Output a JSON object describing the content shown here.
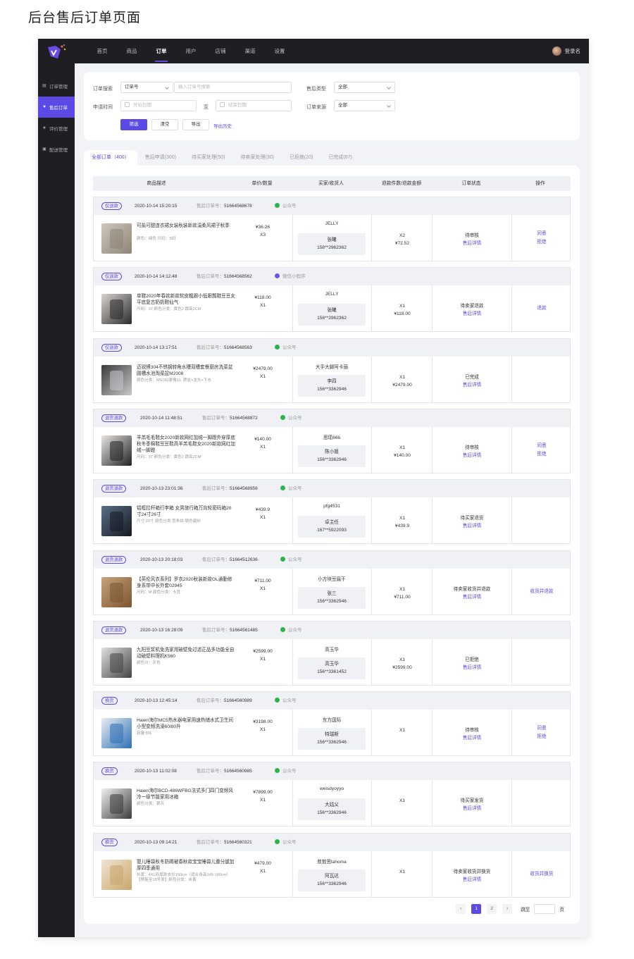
{
  "page_title": "后台售后订单页面",
  "topbar": {
    "nav": [
      "首页",
      "商品",
      "订单",
      "用户",
      "店铺",
      "渠道",
      "设置"
    ],
    "active_index": 2,
    "user_label": "登录名"
  },
  "sidebar": {
    "items": [
      {
        "label": "订单管理",
        "icon": "clipboard-icon",
        "active": false
      },
      {
        "label": "售后订单",
        "icon": "heart-icon",
        "active": true
      },
      {
        "label": "评价管理",
        "icon": "star-icon",
        "active": false
      },
      {
        "label": "配送管理",
        "icon": "box-icon",
        "active": false
      }
    ]
  },
  "filter": {
    "order_search_label": "订单搜索",
    "order_search_select": "订单号",
    "order_search_placeholder": "输入订单号搜索",
    "after_type_label": "售后类型",
    "after_type_value": "全部",
    "apply_time_label": "申请时间",
    "start_placeholder": "开始日期",
    "to_label": "至",
    "end_placeholder": "结束日期",
    "order_source_label": "订单来源",
    "order_source_value": "全部",
    "btn_filter": "筛选",
    "btn_clear": "清空",
    "btn_export": "导出",
    "export_history": "导出历史"
  },
  "tabs": [
    "全部订单（400）",
    "售后申请(300)",
    "待买家处理(50)",
    "待卖家处理(30)",
    "已拒绝(20)",
    "已完成(87)"
  ],
  "table_headers": [
    "商品描述",
    "单价/数量",
    "买家/收货人",
    "退款件数/退款金额",
    "订单状态",
    "操作"
  ],
  "after_no_label": "售后订单号：",
  "detail_label": "售后详情",
  "orders": [
    {
      "tag": "仅退款",
      "time": "2020-10-14 15:20:15",
      "no": "51664568678",
      "channel": "公众号",
      "name": "可盐可甜连衣裙女装秋装新款温柔风裙子秋季",
      "spec": "颜色：绿色 尺码：S码",
      "price": "¥36.26",
      "qty": "X3",
      "buyer": "JELLY",
      "receiver": "张曦",
      "phone": "158**2962362",
      "refund_qty": "X2",
      "refund_amt": "¥72.52",
      "status": "待审核",
      "ops": [
        "同意",
        "拒绝"
      ]
    },
    {
      "tag": "仅退款",
      "time": "2020-10-14 14:12:48",
      "no": "51664568562",
      "channel": "微信小程序",
      "name": "单鞋2020年春款新款软皮粗跟小低跟瓢鞋豆豆女平底复古奶奶鞋仙气",
      "spec": "尺码：37  颜色分类：黄色2 跟高2CM",
      "price": "¥118.00",
      "qty": "X1",
      "buyer": "JELLY",
      "receiver": "张曦",
      "phone": "158**2962362",
      "refund_qty": "X1",
      "refund_amt": "¥118.00",
      "status": "待卖家退款",
      "ops": [
        "退款"
      ]
    },
    {
      "tag": "仅退款",
      "time": "2020-10-14 13:17:51",
      "no": "51664568563",
      "channel": "公众号",
      "name": "迈锐博304不锈钢转角水槽双槽套餐厨房洗菜盆圆槽水池淘菜盆M2008",
      "spec": "颜色分类：MS182套餐11: 牌盆+龙头+下水",
      "price": "¥2479.00",
      "qty": "X1",
      "buyer": "大手大脚阿卡丽",
      "receiver": "李四",
      "phone": "156**3362946",
      "refund_qty": "X1",
      "refund_amt": "¥2479.00",
      "status": "已完成",
      "ops": []
    },
    {
      "tag": "退货退款",
      "time": "2020-10-14 11:48:51",
      "no": "51664568872",
      "channel": "公众号",
      "name": "羊羔毛毛鞋女2020新款网红加绒一脚蹬外穿厚底秋冬季棉鞋豆豆鞋高羊羔毛鞋女2020新款网红加绒一脚蹬",
      "spec": "尺码：37  颜色分类：黄色2 跟高2CM",
      "price": "¥140.00",
      "qty": "X1",
      "buyer": "思瑶666",
      "receiver": "陈小姐",
      "phone": "156**3362946",
      "refund_qty": "X1",
      "refund_amt": "¥140.00",
      "status": "待审核",
      "ops": [
        "同意",
        "拒绝"
      ]
    },
    {
      "tag": "退货退款",
      "time": "2020-10-13 23:01:36",
      "no": "51664568956",
      "channel": "公众号",
      "name": "铝框拉杆箱行李箱 女男旅行箱万向轮密码箱20寸24寸26寸",
      "spec": "尺寸:20寸  颜色分类:宽条纹-银色磨砂",
      "price": "¥439.9",
      "qty": "X1",
      "buyer": "pfg4531",
      "receiver": "卓主任",
      "phone": "167**5922093",
      "refund_qty": "X1",
      "refund_amt": "¥439.9",
      "status": "待买家退货",
      "ops": []
    },
    {
      "tag": "退货退款",
      "time": "2020-10-13 20:18:03",
      "no": "51664512636",
      "channel": "公众号",
      "name": "【英伦风衣系列】罗衣2020秋装新款OL通勤修身系带中长外套02945",
      "spec": "尺码：M  颜色分类：卡其",
      "price": "¥711.00",
      "qty": "X1",
      "buyer": "小方块豆腐干",
      "receiver": "张三",
      "phone": "156**3362946",
      "refund_qty": "X1",
      "refund_amt": "¥711.00",
      "status": "待卖家收货并退款",
      "ops": [
        "收货并退款"
      ]
    },
    {
      "tag": "退货退款",
      "time": "2020-10-13 16:28:09",
      "no": "51664561485",
      "channel": "公众号",
      "name": "九阳豆浆机免洗家用破壁免过滤正品多功能全自动破壁料理机K560",
      "spec": "颜色分：灰色",
      "price": "¥2599.00",
      "qty": "X1",
      "buyer": "高玉华",
      "receiver": "高玉华",
      "phone": "156**3361452",
      "refund_qty": "X1",
      "refund_amt": "¥2599.00",
      "status": "已拒绝",
      "ops": []
    },
    {
      "tag": "换货",
      "time": "2020-10-13 12:45:14",
      "no": "51664560989",
      "channel": "公众号",
      "name": "Haier/海尔MC5热水器电家用速热储水式卫生间小型变频洗澡60/80升",
      "spec": "容量:80L",
      "price": "¥3198.00",
      "qty": "X1",
      "buyer": "东方国际",
      "receiver": "特瑞斯",
      "phone": "156**3362946",
      "refund_qty": "X1",
      "refund_amt": "",
      "status": "待审核",
      "ops": [
        "同意",
        "拒绝"
      ]
    },
    {
      "tag": "换货",
      "time": "2020-10-13 11:02:08",
      "no": "51664560985",
      "channel": "公众号",
      "name": "Haier/海尔BCD-486WFBG法式多门四门变频风冷一级节能家用冰箱",
      "spec": "颜色分类：银灰",
      "price": "¥7899.00",
      "qty": "X1",
      "buyer": "weisdyoyyo",
      "receiver": "大姑父",
      "phone": "156**3362946",
      "refund_qty": "X1",
      "refund_amt": "",
      "status": "待买家发货",
      "ops": []
    },
    {
      "tag": "换货",
      "time": "2020-10-13 09:14:21",
      "no": "51664560321",
      "channel": "公众号",
      "name": "婴儿睡袋秋冬防踢被春秋款宝宝睡袋儿童分腿加厚四季通用",
      "spec": "长度：4XL码厚款衣长150cm（适合身高145-160cm）【预售至18号发】颜色分类：米黄",
      "price": "¥479.00",
      "qty": "X1",
      "buyer": "敖敖思lahoma",
      "receiver": "阿瓦达",
      "phone": "156**3362946",
      "refund_qty": "X1",
      "refund_amt": "",
      "status": "待卖家收货并换货",
      "ops": [
        "收货并换货"
      ]
    }
  ],
  "pager": {
    "prev": "‹",
    "pages": [
      "1",
      "2"
    ],
    "current": "1",
    "next": "›",
    "jump_label": "跳至",
    "page_unit": "页"
  },
  "colors": {
    "accent": "#5b4ae6",
    "sidebar_bg": "#1f1f23",
    "wechat_green": "#29b34a",
    "mini_purple": "#6b55e6"
  }
}
